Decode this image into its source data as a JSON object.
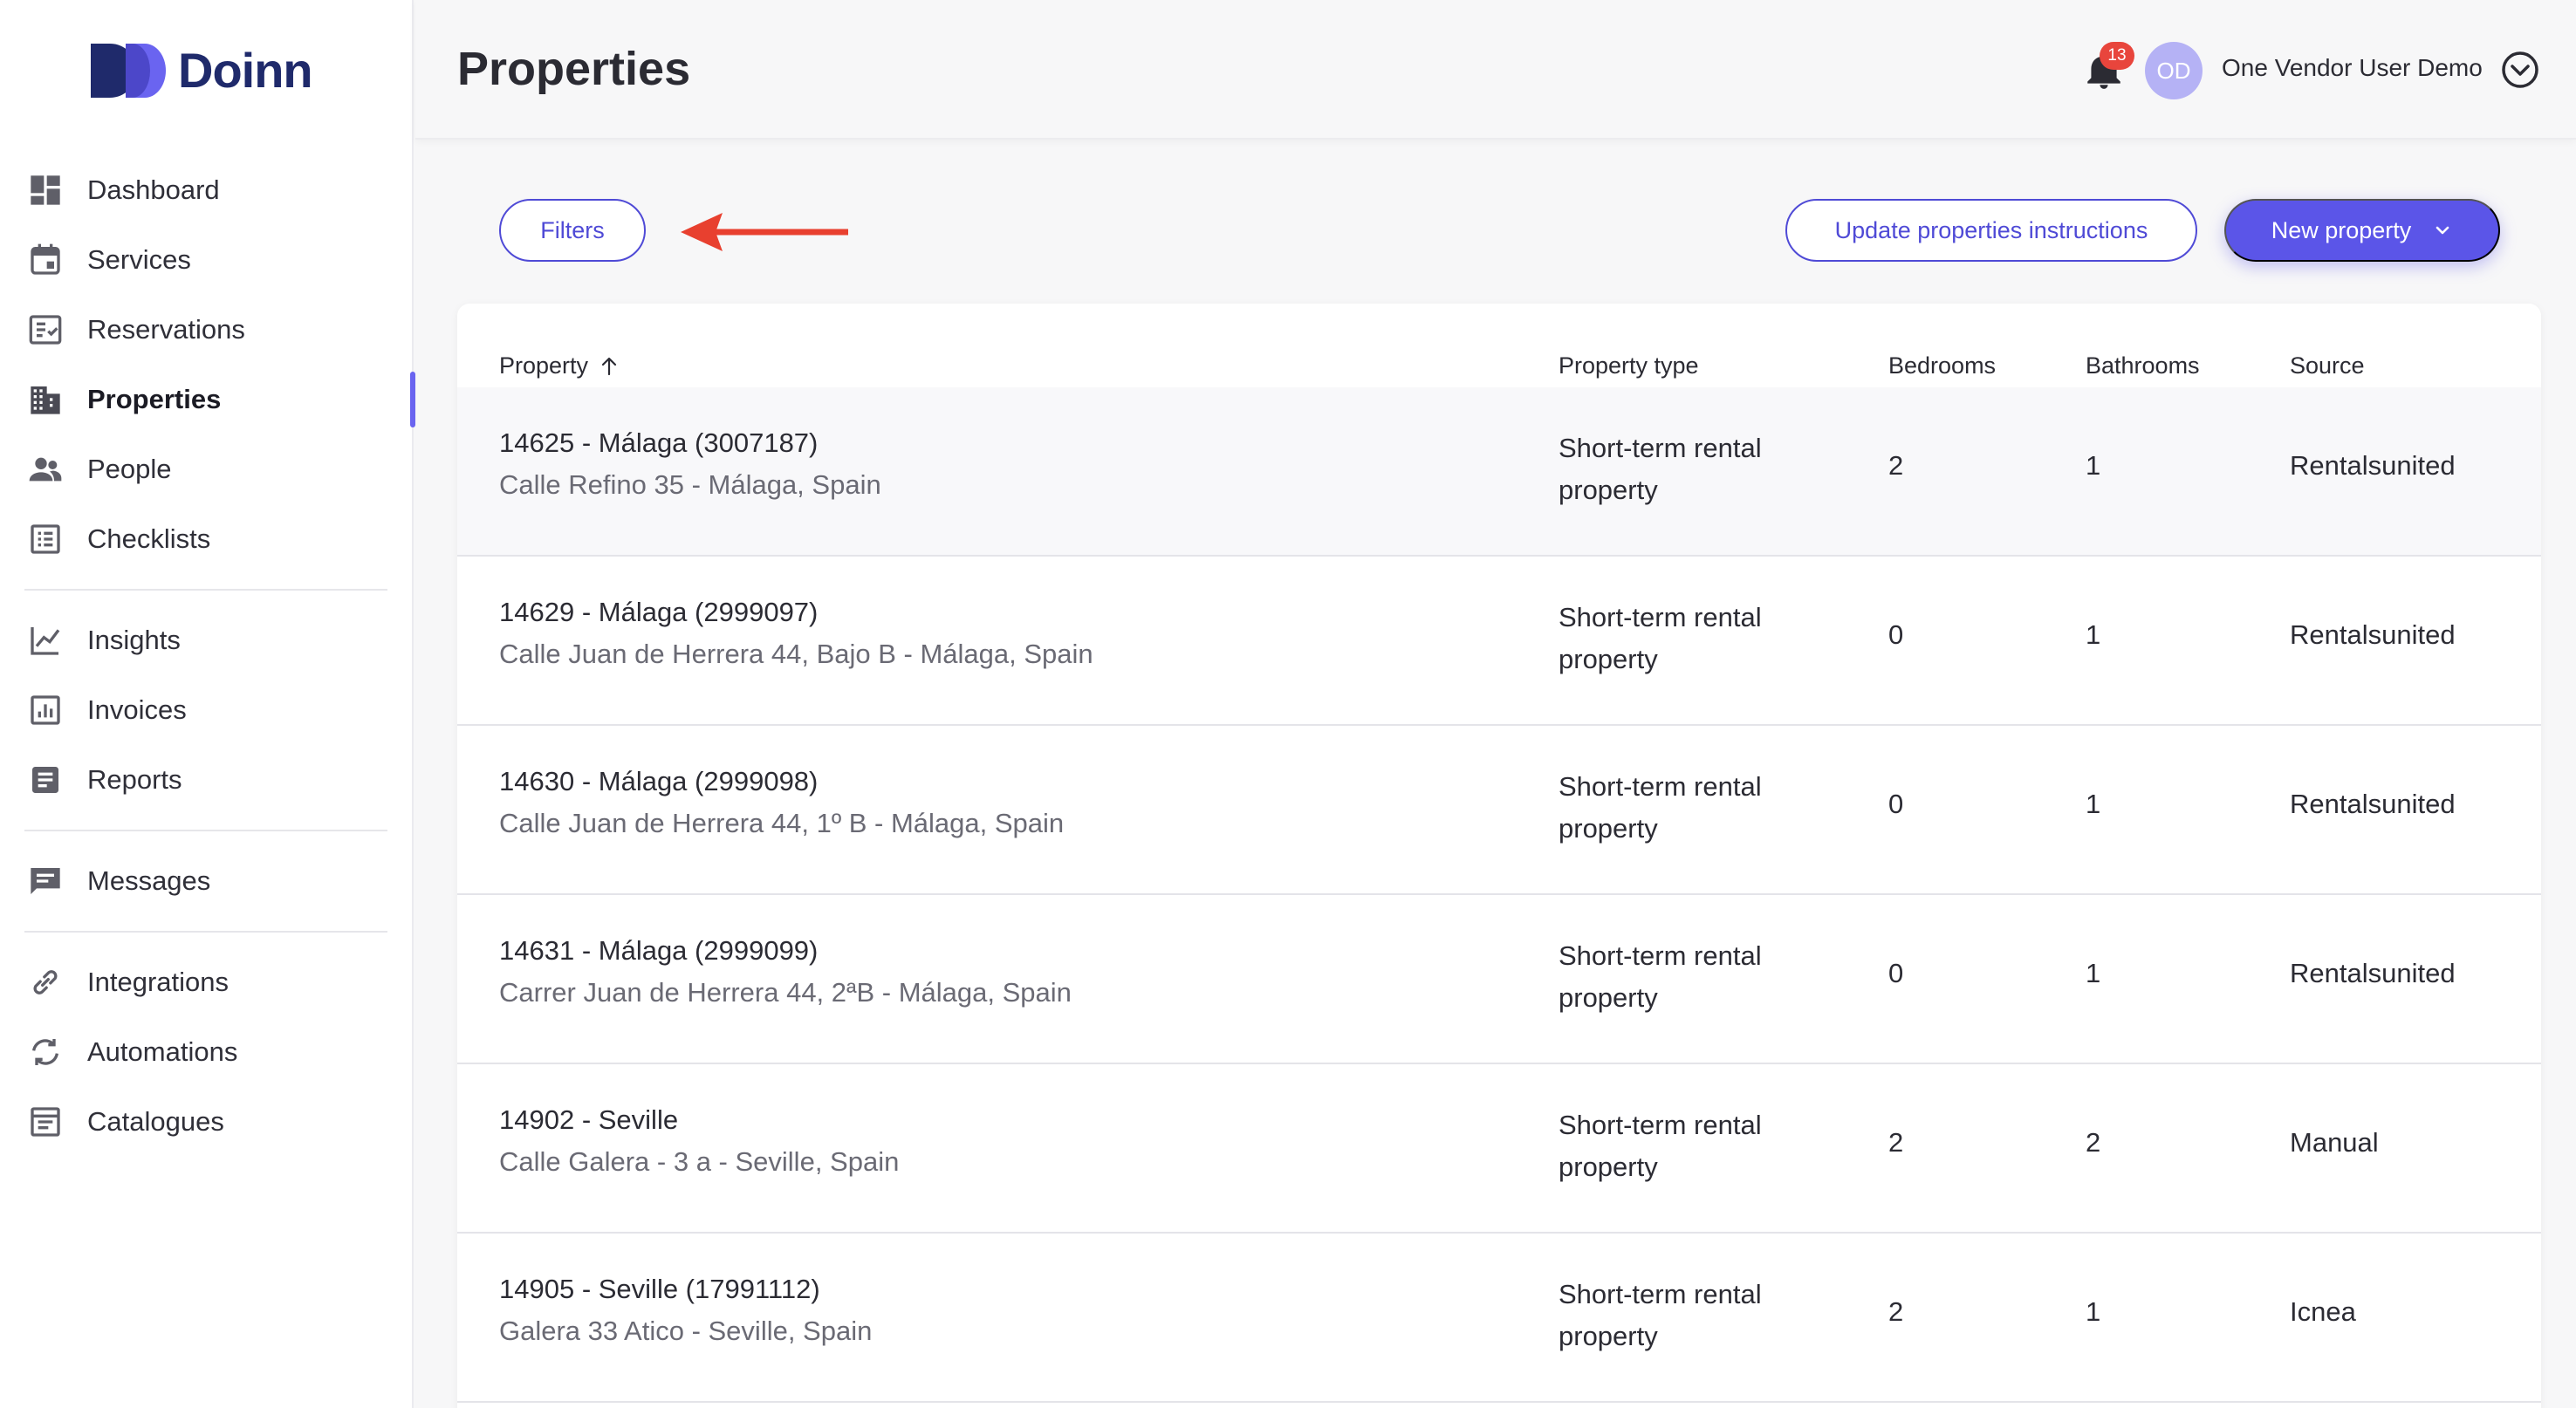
{
  "brand": {
    "name": "Doinn",
    "color": "#1f2a6b"
  },
  "colors": {
    "accent": "#5b55e8",
    "badge": "#e8453c",
    "annotation_arrow": "#e8402f"
  },
  "sidebar": {
    "groups": [
      [
        {
          "label": "Dashboard",
          "icon": "dashboard-icon"
        },
        {
          "label": "Services",
          "icon": "calendar-icon"
        },
        {
          "label": "Reservations",
          "icon": "checklist-box-icon"
        },
        {
          "label": "Properties",
          "icon": "buildings-icon",
          "active": true
        },
        {
          "label": "People",
          "icon": "people-icon"
        },
        {
          "label": "Checklists",
          "icon": "list-icon"
        }
      ],
      [
        {
          "label": "Insights",
          "icon": "line-chart-icon"
        },
        {
          "label": "Invoices",
          "icon": "bar-chart-box-icon"
        },
        {
          "label": "Reports",
          "icon": "document-icon"
        }
      ],
      [
        {
          "label": "Messages",
          "icon": "chat-icon"
        }
      ],
      [
        {
          "label": "Integrations",
          "icon": "link-icon"
        },
        {
          "label": "Automations",
          "icon": "sync-icon"
        },
        {
          "label": "Catalogues",
          "icon": "catalogue-icon"
        }
      ]
    ]
  },
  "header": {
    "title": "Properties",
    "notifications_count": "13",
    "avatar_initials": "OD",
    "user_name": "One Vendor User Demo"
  },
  "toolbar": {
    "filters_label": "Filters",
    "update_label": "Update properties instructions",
    "new_label": "New property"
  },
  "table": {
    "columns": [
      "Property",
      "Property type",
      "Bedrooms",
      "Bathrooms",
      "Source"
    ],
    "rows": [
      {
        "name": "14625 - Málaga (3007187)",
        "address": "Calle Refino 35 - Málaga, Spain",
        "type_line1": "Short-term rental",
        "type_line2": "property",
        "bedrooms": "2",
        "bathrooms": "1",
        "source": "Rentalsunited"
      },
      {
        "name": "14629 - Málaga (2999097)",
        "address": "Calle Juan de Herrera 44, Bajo B - Málaga, Spain",
        "type_line1": "Short-term rental",
        "type_line2": "property",
        "bedrooms": "0",
        "bathrooms": "1",
        "source": "Rentalsunited"
      },
      {
        "name": "14630 - Málaga (2999098)",
        "address": "Calle Juan de Herrera 44, 1º B - Málaga, Spain",
        "type_line1": "Short-term rental",
        "type_line2": "property",
        "bedrooms": "0",
        "bathrooms": "1",
        "source": "Rentalsunited"
      },
      {
        "name": "14631 - Málaga (2999099)",
        "address": "Carrer Juan de Herrera 44, 2ªB - Málaga, Spain",
        "type_line1": "Short-term rental",
        "type_line2": "property",
        "bedrooms": "0",
        "bathrooms": "1",
        "source": "Rentalsunited"
      },
      {
        "name": "14902 - Seville",
        "address": "Calle Galera - 3 a - Seville, Spain",
        "type_line1": "Short-term rental",
        "type_line2": "property",
        "bedrooms": "2",
        "bathrooms": "2",
        "source": "Manual"
      },
      {
        "name": "14905 - Seville (17991112)",
        "address": "Galera 33 Atico - Seville, Spain",
        "type_line1": "Short-term rental",
        "type_line2": "property",
        "bedrooms": "2",
        "bathrooms": "1",
        "source": "Icnea"
      }
    ]
  }
}
